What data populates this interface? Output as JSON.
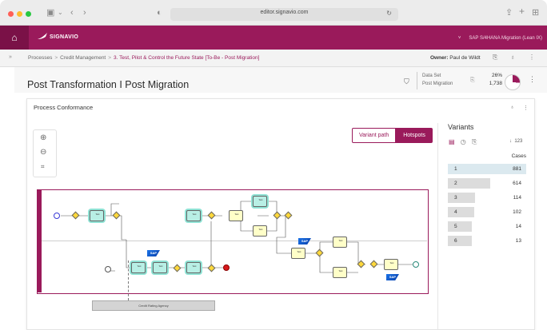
{
  "browser": {
    "url": "editor.signavio.com"
  },
  "header": {
    "logo_text": "SIGNAVIO",
    "workspace": "SAP S/4HANA Migration (Lean IX)",
    "accent_color": "#9a1a5b"
  },
  "breadcrumb": {
    "items": [
      "Processes",
      "Credit Management",
      "3. Test, Pilot & Control the Future State [To-Be - Post Migration]"
    ],
    "owner_label": "Owner:",
    "owner_name": "Paul de Wildt"
  },
  "dashboard": {
    "title": "Post Transformation I Post Migration",
    "dataset_label": "Data Set",
    "dataset_name": "Post Migration",
    "percent": "26%",
    "count": "1,738",
    "percent_value": 26
  },
  "card": {
    "title": "Process Conformance",
    "view_toggle": {
      "variant_path": "Variant path",
      "hotspots": "Hotspots",
      "selected": "Hotspots"
    }
  },
  "variants": {
    "title": "Variants",
    "sort_count": "123",
    "cases_header": "Cases",
    "rows": [
      {
        "index": "1",
        "cases": "881",
        "cases_value": 881
      },
      {
        "index": "2",
        "cases": "614",
        "cases_value": 614
      },
      {
        "index": "3",
        "cases": "114",
        "cases_value": 114
      },
      {
        "index": "4",
        "cases": "102",
        "cases_value": 102
      },
      {
        "index": "5",
        "cases": "14",
        "cases_value": 14
      },
      {
        "index": "6",
        "cases": "13",
        "cases_value": 13
      }
    ]
  },
  "diagram": {
    "agency_label": "Credit Rating Agency",
    "sap_label": "SAP"
  }
}
